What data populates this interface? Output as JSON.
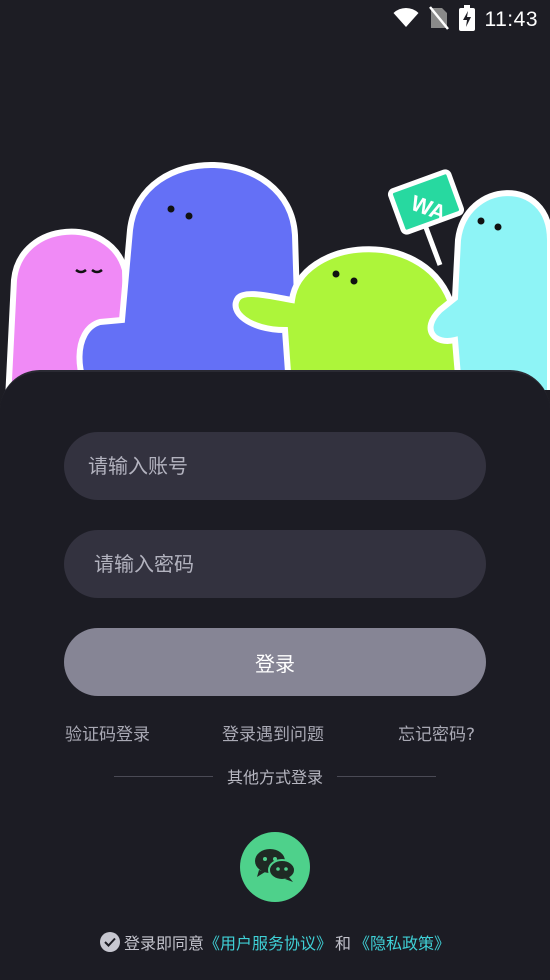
{
  "status_bar": {
    "time": "11:43",
    "icons": [
      "wifi-icon",
      "no-sim-icon",
      "battery-charging-icon"
    ]
  },
  "illustration": {
    "sign_text": "WA"
  },
  "form": {
    "account_placeholder": "请输入账号",
    "password_placeholder": "请输入密码",
    "login_label": "登录"
  },
  "links": {
    "sms_login": "验证码登录",
    "login_problem": "登录遇到问题",
    "forgot_password": "忘记密码?"
  },
  "other_login": {
    "label": "其他方式登录",
    "wechat_icon": "wechat-icon"
  },
  "agreement": {
    "prefix": "登录即同意",
    "user_agreement": "《用户服务协议》",
    "and": "和",
    "privacy_policy": "《隐私政策》"
  },
  "colors": {
    "background": "#1d1d24",
    "input_bg": "#33323f",
    "button_bg": "#868595",
    "wechat_green": "#4ed18b",
    "link_cyan": "#3fd0d6",
    "blob_pink": "#f08af6",
    "blob_blue": "#6470f6",
    "blob_green": "#adf53a",
    "blob_cyan": "#8ef4f6",
    "sign_green": "#27d9a0"
  }
}
